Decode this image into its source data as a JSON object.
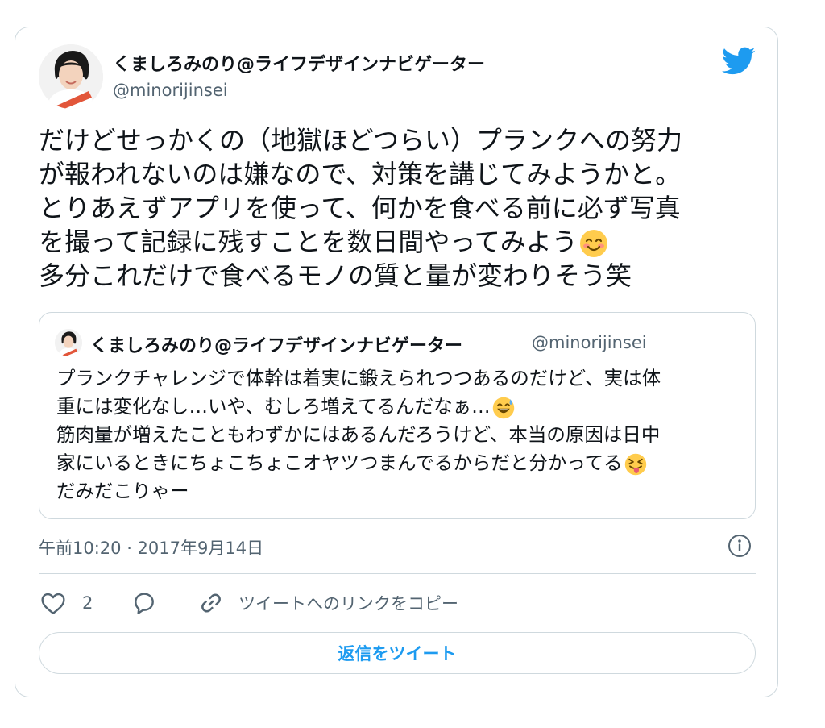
{
  "tweet": {
    "author": {
      "display_name": "くましろみのり@ライフデザインナビゲーター",
      "handle": "@minorijinsei"
    },
    "text_lines": [
      "だけどせっかくの（地獄ほどつらい）プランクへの努力",
      "が報われないのは嫌なので、対策を講じてみようかと。",
      "とりあえずアプリを使って、何かを食べる前に必ず写真",
      "を撮って記録に残すことを数日間やってみよう",
      "多分これだけで食べるモノの質と量が変わりそう笑"
    ],
    "text_emoji": "smiling-face-with-smiling-eyes",
    "quoted": {
      "display_name": "くましろみのり@ライフデザインナビゲーター",
      "handle": "@minorijinsei",
      "text_lines": [
        "プランクチャレンジで体幹は着実に鍛えられつつあるのだけど、実は体",
        "重には変化なし…いや、むしろ増えてるんだなぁ…",
        "筋肉量が増えたこともわずかにはあるんだろうけど、本当の原因は日中",
        "家にいるときにちょこちょこオヤツつまんでるからだと分かってる",
        "だみだこりゃー"
      ],
      "emojis": [
        "grinning-face-with-sweat",
        "squinting-face-with-tongue"
      ]
    },
    "timestamp": "午前10:20 · 2017年9月14日",
    "actions": {
      "like_count": "2",
      "copy_link_label": "ツイートへのリンクをコピー"
    },
    "reply_button_label": "返信をツイート"
  },
  "colors": {
    "twitter_blue": "#1d9bf0",
    "text": "#0f1419",
    "secondary": "#536471",
    "border": "#cfd9de"
  }
}
